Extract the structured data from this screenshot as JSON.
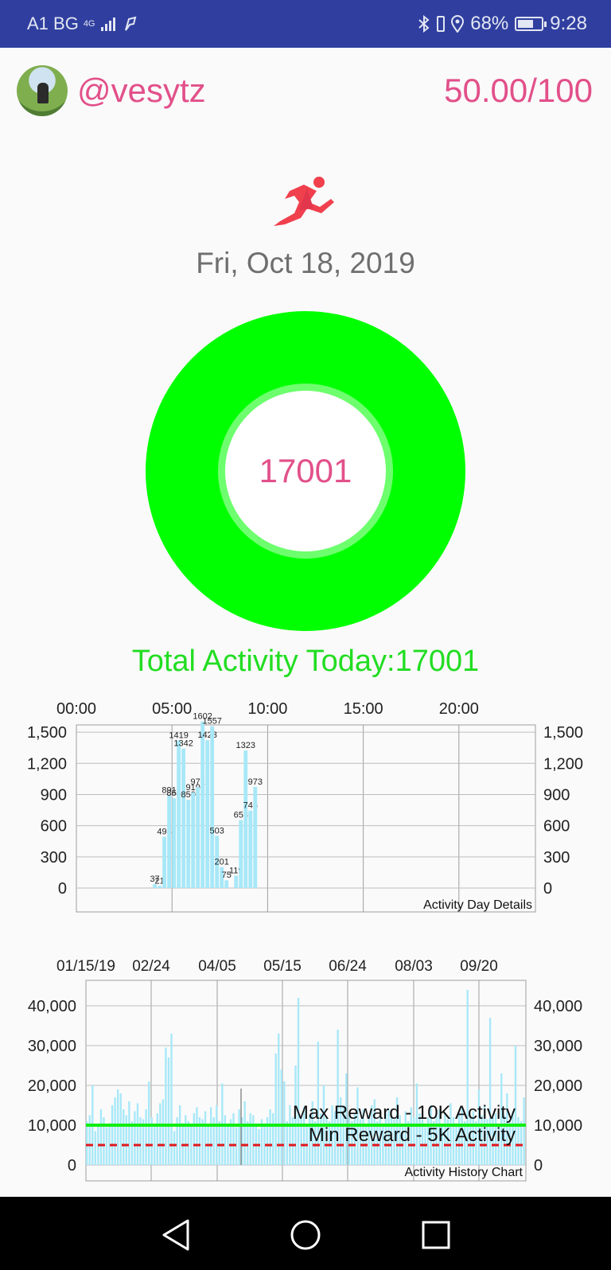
{
  "status_bar": {
    "carrier": "A1 BG",
    "network": "4G",
    "battery": "68%",
    "battery_level": 0.68,
    "time": "9:28"
  },
  "header": {
    "username": "@vesytz",
    "score": "50.00/100"
  },
  "activity_icon": "running-person-icon",
  "date": "Fri, Oct 18, 2019",
  "ring": {
    "value": "17001",
    "ring_color": "#00ff00"
  },
  "total_label": "Total Activity Today:17001",
  "colors": {
    "accent": "#e2508a",
    "status_bar": "#303f9f",
    "ring": "#00ff00",
    "total_text": "#22dd22",
    "bar": "#a7e8f8",
    "max_line": "#11ee11",
    "min_line": "#e0181c"
  },
  "chart_data": [
    {
      "type": "bar",
      "title": "Activity Day Details",
      "xlim": [
        0,
        24
      ],
      "x_ticks": [
        "00:00",
        "05:00",
        "10:00",
        "15:00",
        "20:00"
      ],
      "x_tick_values": [
        0,
        5,
        10,
        15,
        20
      ],
      "y_ticks": [
        "0",
        "300",
        "600",
        "900",
        "1,200",
        "1,500"
      ],
      "y_tick_values": [
        0,
        300,
        600,
        900,
        1200,
        1500
      ],
      "ylim": [
        0,
        1600
      ],
      "grid": true,
      "points": [
        {
          "x": 4.0,
          "y": 37,
          "label": "37"
        },
        {
          "x": 4.25,
          "y": 21,
          "label": "21"
        },
        {
          "x": 4.5,
          "y": 493,
          "label": "493"
        },
        {
          "x": 4.75,
          "y": 891,
          "label": "891"
        },
        {
          "x": 5.0,
          "y": 864,
          "label": "864"
        },
        {
          "x": 5.25,
          "y": 1419,
          "label": "1419"
        },
        {
          "x": 5.5,
          "y": 1342,
          "label": "1342"
        },
        {
          "x": 5.75,
          "y": 850,
          "label": "850"
        },
        {
          "x": 6.0,
          "y": 919,
          "label": "919"
        },
        {
          "x": 6.25,
          "y": 971,
          "label": "971"
        },
        {
          "x": 6.5,
          "y": 1602,
          "label": "1602"
        },
        {
          "x": 6.75,
          "y": 1423,
          "label": "1423"
        },
        {
          "x": 7.0,
          "y": 1557,
          "label": "1557"
        },
        {
          "x": 7.25,
          "y": 503,
          "label": "503"
        },
        {
          "x": 7.5,
          "y": 201,
          "label": "201"
        },
        {
          "x": 7.75,
          "y": 75,
          "label": "75"
        },
        {
          "x": 8.25,
          "y": 119,
          "label": "119"
        },
        {
          "x": 8.5,
          "y": 653,
          "label": "653"
        },
        {
          "x": 8.75,
          "y": 1323,
          "label": "1323"
        },
        {
          "x": 9.0,
          "y": 745,
          "label": "745"
        },
        {
          "x": 9.25,
          "y": 973,
          "label": "973"
        }
      ]
    },
    {
      "type": "bar",
      "title": "Activity History Chart",
      "x_ticks": [
        "01/15/19",
        "02/24",
        "04/05",
        "05/15",
        "06/24",
        "08/03",
        "09/20"
      ],
      "y_ticks": [
        "0",
        "10,000",
        "20,000",
        "30,000",
        "40,000"
      ],
      "y_tick_values": [
        0,
        10000,
        20000,
        30000,
        40000
      ],
      "ylim": [
        0,
        48000
      ],
      "grid": true,
      "reference_lines": [
        {
          "label": "Max Reward - 10K Activity",
          "value": 10000,
          "style": "solid",
          "color": "#11ee11"
        },
        {
          "label": "Min Reward - 5K Activity",
          "value": 5000,
          "style": "dashed",
          "color": "#e0181c"
        }
      ],
      "values": [
        11000,
        12500,
        20000,
        8500,
        10000,
        14000,
        12000,
        9500,
        10500,
        15000,
        17000,
        19000,
        18000,
        14000,
        12500,
        16000,
        11000,
        13500,
        15500,
        12000,
        11500,
        14000,
        21000,
        12000,
        10000,
        13000,
        15500,
        16500,
        29500,
        27000,
        33000,
        8500,
        12000,
        15000,
        10500,
        12500,
        11000,
        10000,
        13000,
        14500,
        12000,
        11500,
        13500,
        10000,
        14500,
        12000,
        15000,
        11000,
        20500,
        12500,
        10000,
        11500,
        13000,
        9500,
        14000,
        12000,
        16000,
        11000,
        13000,
        12500,
        10000,
        9000,
        11500,
        10500,
        12000,
        14000,
        13000,
        28000,
        33000,
        24000,
        21000,
        11000,
        15000,
        12000,
        25000,
        42000,
        12000,
        14500,
        10000,
        12500,
        16000,
        11000,
        31000,
        13000,
        20000,
        12000,
        11000,
        15000,
        13500,
        34000,
        17000,
        15000,
        23000,
        12500,
        11000,
        13000,
        19500,
        11500,
        14000,
        10000,
        12500,
        15000,
        16500,
        11000,
        12000,
        10500,
        13000,
        14000,
        12000,
        11500,
        17000,
        12500,
        10000,
        13500,
        11000,
        14500,
        12000,
        20500,
        13000,
        11500,
        9500,
        12000,
        15000,
        11000,
        12500,
        14000,
        10000,
        13000,
        11500,
        15500,
        12000,
        10500,
        13000,
        14500,
        11000,
        44000,
        12000,
        13500,
        11000,
        19000,
        12500,
        15000,
        11500,
        37000,
        12000,
        13000,
        10000,
        23000,
        12500,
        18000,
        11000,
        13500,
        30000,
        12000,
        11000,
        17000
      ]
    }
  ],
  "nav": {
    "back": "back-icon",
    "home": "home-icon",
    "recents": "recents-icon"
  }
}
